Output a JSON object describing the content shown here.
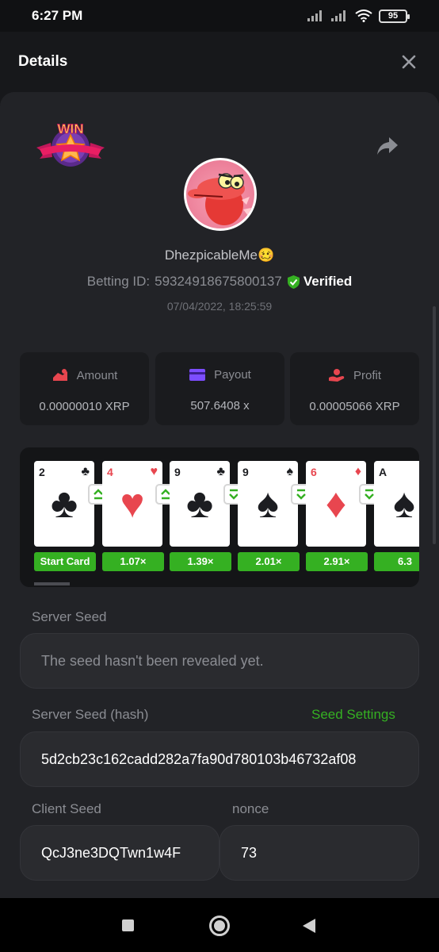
{
  "status": {
    "time": "6:27 PM",
    "battery": "95"
  },
  "header": {
    "title": "Details",
    "close_icon": "close-icon"
  },
  "bet": {
    "username": "DhezpicableMe🥴",
    "betting_id_label": "Betting ID:",
    "betting_id": "59324918675800137",
    "verified": "Verified",
    "datetime": "07/04/2022, 18:25:59",
    "badge_text": "WIN"
  },
  "stats": {
    "amount": {
      "label": "Amount",
      "value": "0.00000010 XRP"
    },
    "payout": {
      "label": "Payout",
      "value": "507.6408 x"
    },
    "profit": {
      "label": "Profit",
      "value": "0.00005066 XRP"
    }
  },
  "cards": [
    {
      "rank": "2",
      "suit": "♣",
      "color": "black"
    },
    {
      "rank": "4",
      "suit": "♥",
      "color": "red"
    },
    {
      "rank": "9",
      "suit": "♣",
      "color": "black"
    },
    {
      "rank": "9",
      "suit": "♠",
      "color": "black"
    },
    {
      "rank": "6",
      "suit": "♦",
      "color": "red"
    },
    {
      "rank": "A",
      "suit": "♠",
      "color": "black"
    }
  ],
  "arrows": [
    "higher",
    "higher",
    "lower",
    "lower",
    "lower"
  ],
  "multipliers": [
    "Start Card",
    "1.07×",
    "1.39×",
    "2.01×",
    "2.91×",
    "6.3"
  ],
  "fairness": {
    "server_seed_label": "Server Seed",
    "server_seed_value": "The seed hasn't been revealed yet.",
    "server_seed_hash_label": "Server Seed (hash)",
    "seed_settings_link": "Seed Settings",
    "server_seed_hash_value": "5d2cb23c162cadd282a7fa90d780103b46732af08",
    "client_seed_label": "Client Seed",
    "client_seed_value": "QcJ3ne3DQTwn1w4F",
    "nonce_label": "nonce",
    "nonce_value": "73"
  },
  "colors": {
    "accent_green": "#35b022",
    "background": "#17181b",
    "panel": "#222327"
  }
}
